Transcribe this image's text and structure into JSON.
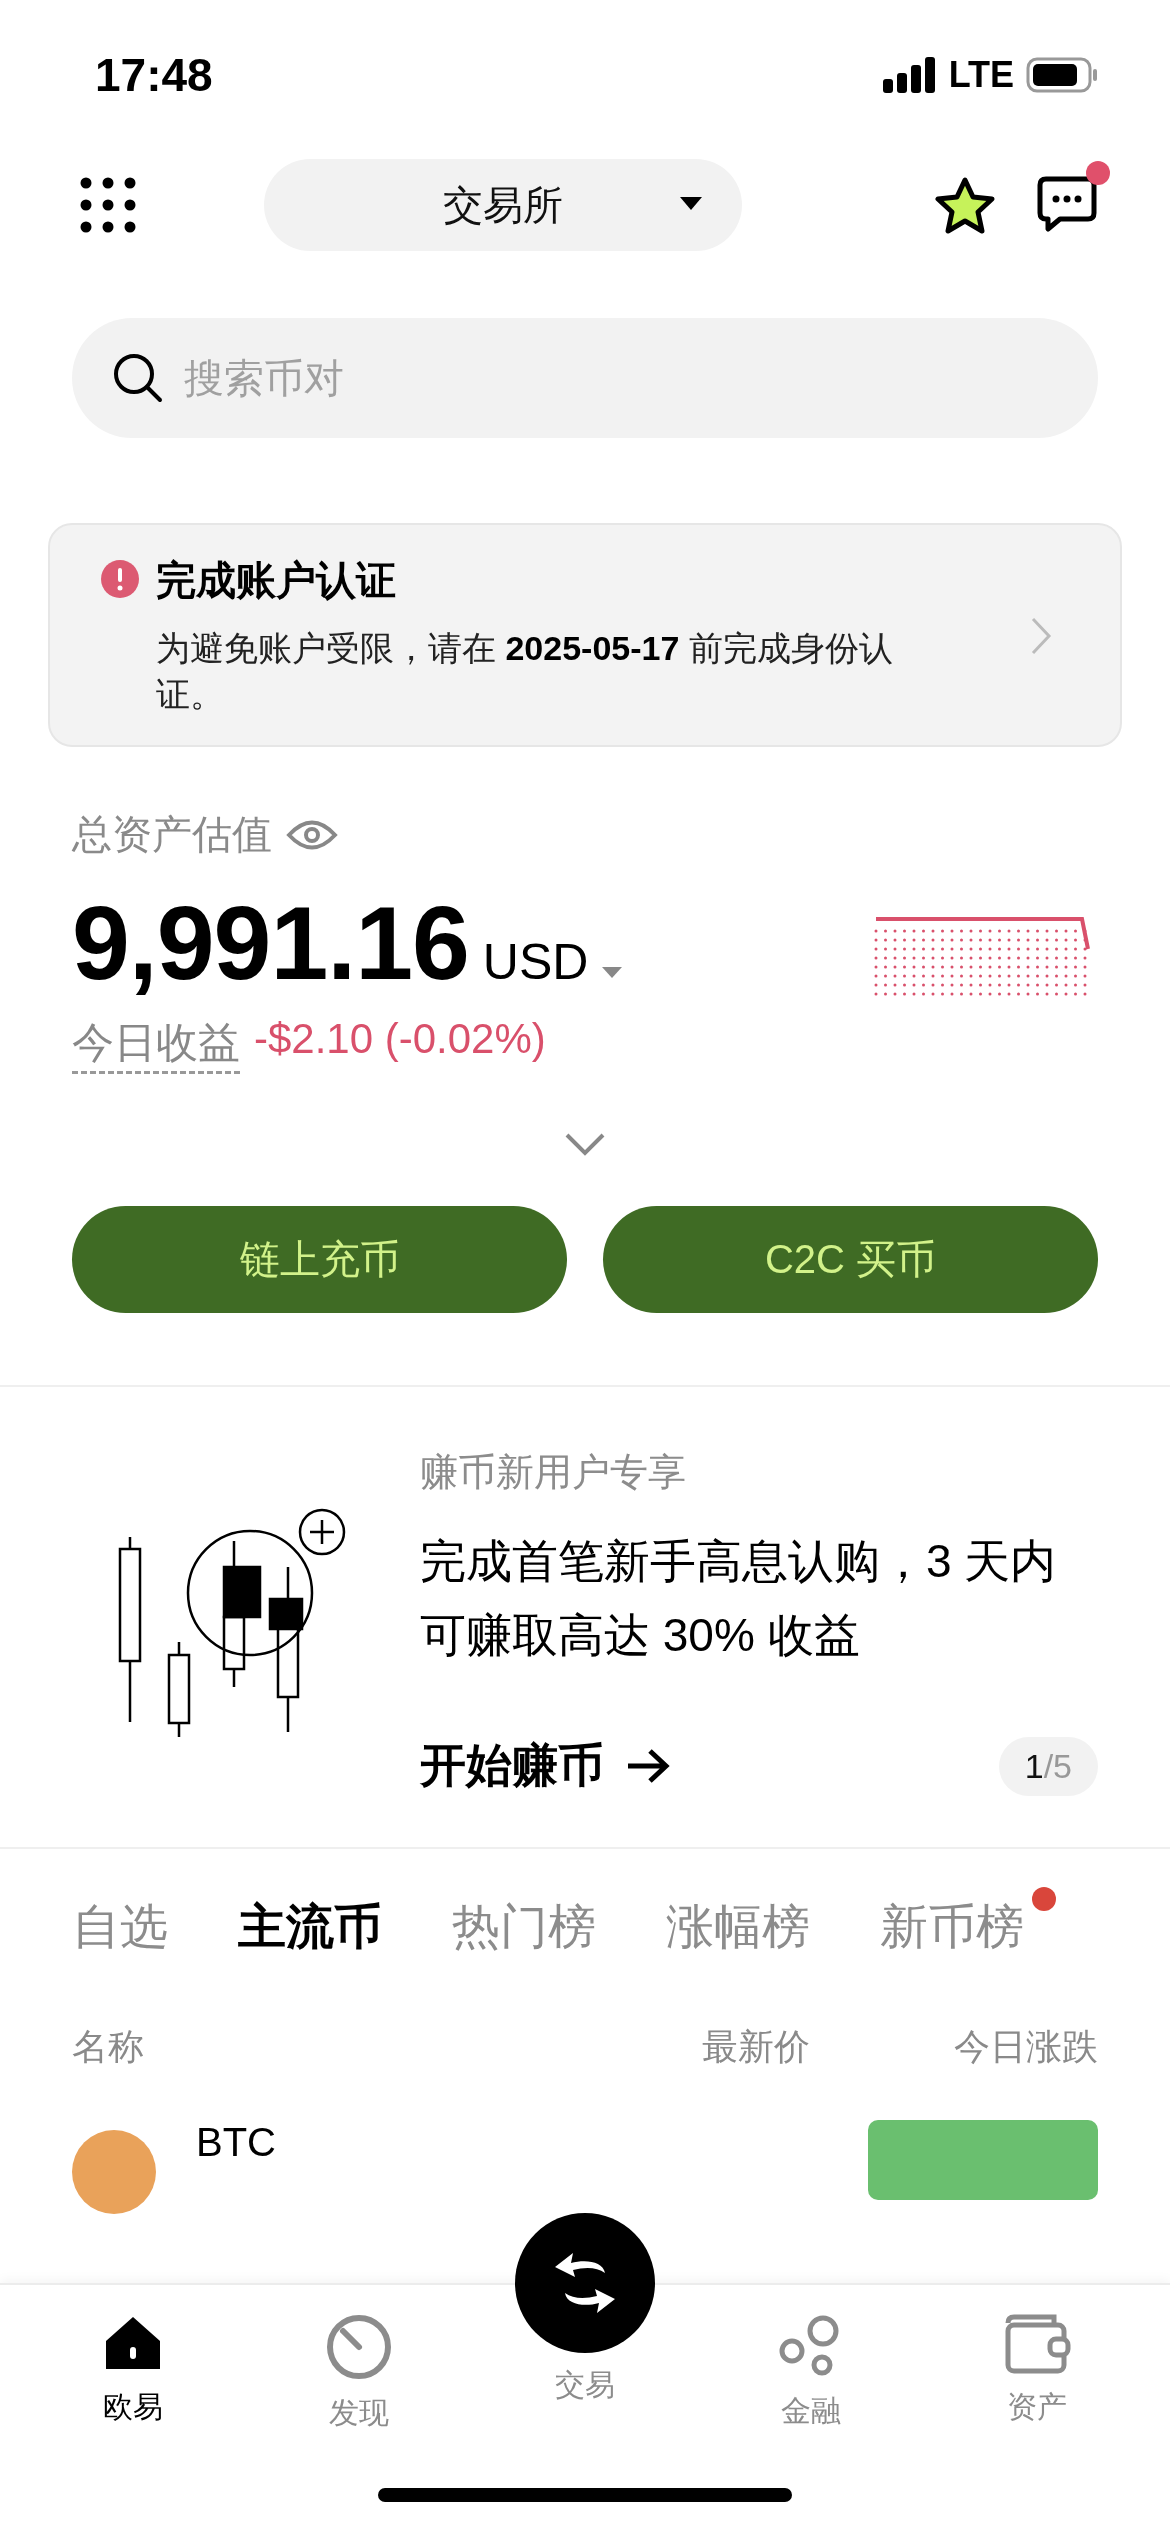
{
  "status_bar": {
    "time": "17:48",
    "network": "LTE"
  },
  "header": {
    "exchange_selector": "交易所",
    "messages_unread": true
  },
  "search": {
    "placeholder": "搜索币对"
  },
  "alert": {
    "title": "完成账户认证",
    "body": "为避免账户受限，请在 **2025-05-17** 前完成身份认证。"
  },
  "assets": {
    "label": "总资产估值",
    "value": "9,991.16",
    "currency": "USD",
    "pnl_label": "今日收益",
    "pnl": "-$2.10 (-0.02%)"
  },
  "actions": [
    {
      "label": "链上充币"
    },
    {
      "label": "C2C 买币"
    }
  ],
  "promo": {
    "kicker": "赚币新用户专享",
    "title": "完成首笔新手高息认购，3 天内可赚取高达 30% 收益",
    "cta": "开始赚币",
    "page": "1",
    "page_total": "/5"
  },
  "market_tabs": [
    {
      "label": "自选",
      "selected": false,
      "dot": false
    },
    {
      "label": "主流币",
      "selected": true,
      "dot": false
    },
    {
      "label": "热门榜",
      "selected": false,
      "dot": false
    },
    {
      "label": "涨幅榜",
      "selected": false,
      "dot": false
    },
    {
      "label": "新币榜",
      "selected": false,
      "dot": true
    }
  ],
  "columns": {
    "name": "名称",
    "price": "最新价",
    "change": "今日涨跌"
  },
  "rows": [
    {
      "symbol": "BTC",
      "change_positive": true
    }
  ],
  "nav": [
    {
      "label": "欧易",
      "kind": "home",
      "selected": true
    },
    {
      "label": "发现",
      "kind": "discover",
      "selected": false
    },
    {
      "label": "交易",
      "kind": "trade",
      "selected": false
    },
    {
      "label": "金融",
      "kind": "finance",
      "selected": false
    },
    {
      "label": "资产",
      "kind": "assets",
      "selected": false
    }
  ]
}
